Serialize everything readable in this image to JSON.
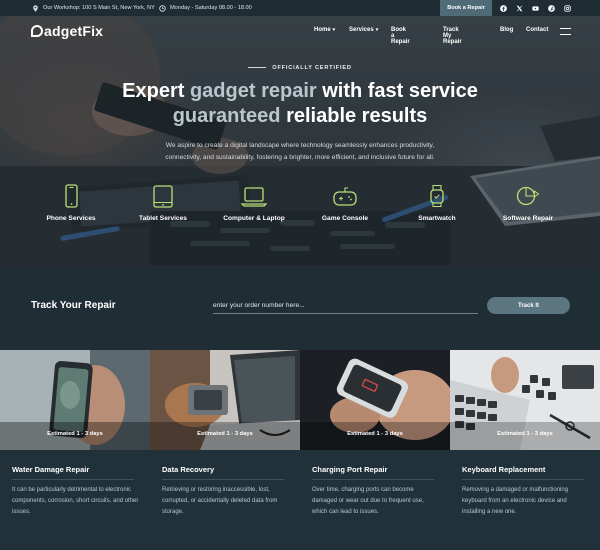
{
  "topbar": {
    "address": "Our Workshop: 100 S Main St, New York, NY",
    "hours": "Monday - Saturday 08.00 - 18.00",
    "book_label": "Book a Repair",
    "socials": [
      "facebook-icon",
      "x-icon",
      "youtube-icon",
      "pinterest-icon",
      "instagram-icon"
    ]
  },
  "nav": {
    "logo": "adgetFix",
    "items": [
      "Home",
      "Services",
      "Book a Repair",
      "Track My Repair",
      "Blog",
      "Contact"
    ]
  },
  "hero": {
    "eyebrow": "OFFICIALLY CERTIFIED",
    "headline_1a": "Expert ",
    "headline_1b": "gadget repair",
    "headline_1c": " with fast service",
    "headline_2a": "guaranteed",
    "headline_2b": " reliable results",
    "description": "We aspire to create a digital landscape where technology seamlessly enhances productivity, connectivity, and sustainability, fostering a brighter, more efficient, and inclusive future for all."
  },
  "services": [
    {
      "label": "Phone Services",
      "icon": "phone-icon"
    },
    {
      "label": "Tablet Services",
      "icon": "tablet-icon"
    },
    {
      "label": "Computer & Laptop",
      "icon": "laptop-icon"
    },
    {
      "label": "Game Console",
      "icon": "gamepad-icon"
    },
    {
      "label": "Smartwatch",
      "icon": "smartwatch-icon"
    },
    {
      "label": "Software Repair",
      "icon": "software-icon"
    }
  ],
  "track": {
    "title": "Track Your Repair",
    "placeholder": "enter your order number here...",
    "button": "Track It"
  },
  "cards": [
    {
      "estimate": "Estimated 1 - 3 days",
      "title": "Water Damage Repair",
      "desc": "It can be particularly detrimental to electronic components, corrosion, short circuits, and other issues."
    },
    {
      "estimate": "Estimated 1 - 3 days",
      "title": "Data Recovery",
      "desc": "Retrieving or restoring inaccessible, lost, corrupted, or accidentally deleted data from storage."
    },
    {
      "estimate": "Estimated 1 - 3 days",
      "title": "Charging Port Repair",
      "desc": "Over time, charging ports can become damaged or wear out due to frequent use, which can lead to issues."
    },
    {
      "estimate": "Estimated 1 - 3 days",
      "title": "Keyboard Replacement",
      "desc": "Removing a damaged or malfunctioning keyboard from an electronic device and installing a new one."
    }
  ],
  "colors": {
    "dark_bg": "#1f2d35",
    "accent": "#5b7581",
    "service_icon": "#b7e07a"
  }
}
